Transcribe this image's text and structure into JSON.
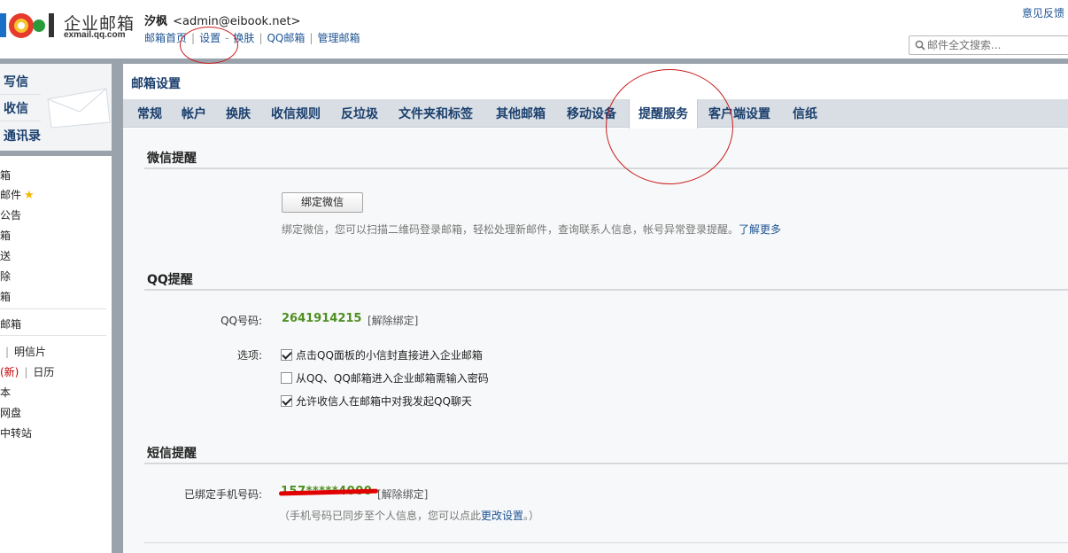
{
  "header": {
    "brand": "企业邮箱",
    "brand_sub": "exmail.qq.com",
    "user_name": "汐枫",
    "user_email": "<admin@eibook.net>",
    "links": [
      {
        "label": "邮箱首页"
      },
      {
        "label": "设置"
      },
      {
        "label": "换肤"
      },
      {
        "label": "QQ邮箱"
      },
      {
        "label": "管理邮箱"
      }
    ],
    "feedback": "意见反馈",
    "search_placeholder": "邮件全文搜索..."
  },
  "sidebar": {
    "primary": [
      {
        "label": "写信"
      },
      {
        "label": "收信"
      },
      {
        "label": "通讯录"
      }
    ],
    "folders": [
      {
        "label": "箱"
      },
      {
        "label": "邮件"
      },
      {
        "label": "公告"
      },
      {
        "label": "箱"
      },
      {
        "label": "送"
      },
      {
        "label": "除"
      },
      {
        "label": "箱"
      },
      {
        "label": "邮箱"
      },
      {
        "label": "明信片"
      },
      {
        "label": "(新)"
      },
      {
        "label": "日历"
      },
      {
        "label": "本"
      },
      {
        "label": "网盘"
      },
      {
        "label": "中转站"
      }
    ]
  },
  "main": {
    "title": "邮箱设置",
    "tabs": [
      {
        "label": "常规"
      },
      {
        "label": "帐户"
      },
      {
        "label": "换肤"
      },
      {
        "label": "收信规则"
      },
      {
        "label": "反垃圾"
      },
      {
        "label": "文件夹和标签"
      },
      {
        "label": "其他邮箱"
      },
      {
        "label": "移动设备"
      },
      {
        "label": "提醒服务",
        "active": true
      },
      {
        "label": "客户端设置"
      },
      {
        "label": "信纸"
      }
    ],
    "wechat": {
      "title": "微信提醒",
      "button": "绑定微信",
      "description": "绑定微信，您可以扫描二维码登录邮箱，轻松处理新邮件，查询联系人信息，帐号异常登录提醒。",
      "more_link": "了解更多"
    },
    "qq": {
      "title": "QQ提醒",
      "qq_label": "QQ号码:",
      "qq_number": "2641914215",
      "unbind": "[解除绑定]",
      "options_label": "选项:",
      "options": [
        {
          "label": "点击QQ面板的小信封直接进入企业邮箱",
          "checked": true
        },
        {
          "label": "从QQ、QQ邮箱进入企业邮箱需输入密码",
          "checked": false
        },
        {
          "label": "允许收信人在邮箱中对我发起QQ聊天",
          "checked": true
        }
      ]
    },
    "sms": {
      "title": "短信提醒",
      "phone_label": "已绑定手机号码:",
      "phone_value": "157*****4000",
      "unbind": "[解除绑定]",
      "note_prefix": "（手机号码已同步至个人信息，您可以点此",
      "note_link": "更改设置",
      "note_suffix": "。）"
    }
  },
  "colors": {
    "nav_blue": "#1e5494",
    "frame_gray": "#9aa3ab",
    "tab_bar": "#d8dee4",
    "qq_green": "#4f8e21",
    "annotation_red": "#c81e1e"
  }
}
